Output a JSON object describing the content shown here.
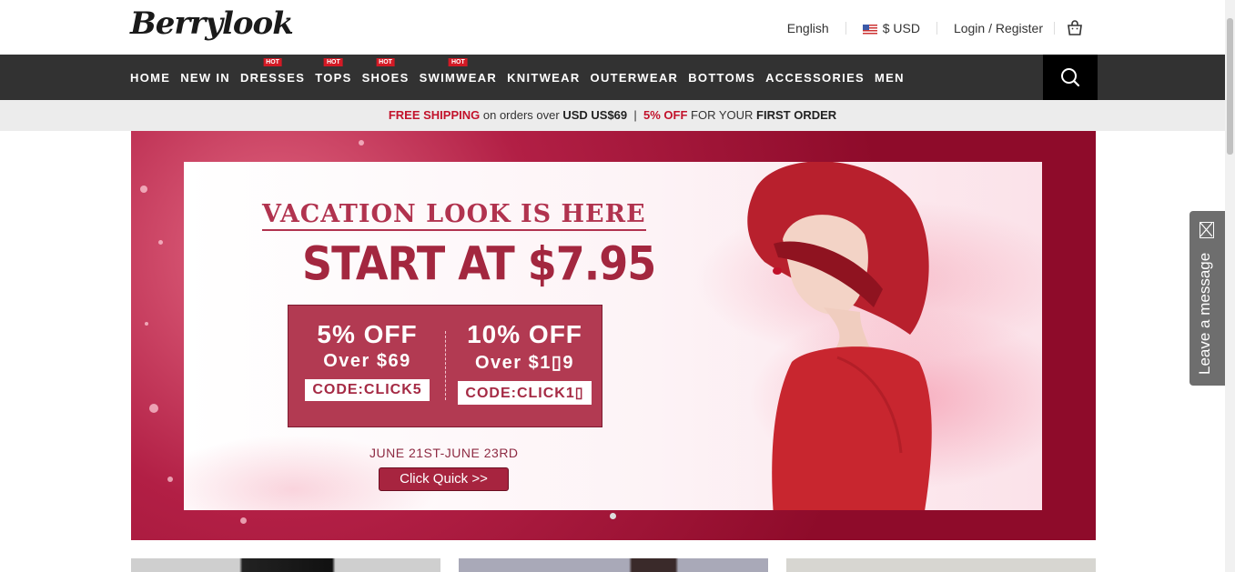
{
  "header": {
    "logo": "Berrylook",
    "language": "English",
    "currency": "$ USD",
    "login": "Login / Register"
  },
  "nav": {
    "items": [
      {
        "label": "HOME",
        "hot": ""
      },
      {
        "label": "NEW IN",
        "hot": ""
      },
      {
        "label": "DRESSES",
        "hot": "HOT"
      },
      {
        "label": "TOPS",
        "hot": "HOT"
      },
      {
        "label": "SHOES",
        "hot": "HOT"
      },
      {
        "label": "SWIMWEAR",
        "hot": "HOT"
      },
      {
        "label": "KNITWEAR",
        "hot": ""
      },
      {
        "label": "OUTERWEAR",
        "hot": ""
      },
      {
        "label": "BOTTOMS",
        "hot": ""
      },
      {
        "label": "ACCESSORIES",
        "hot": ""
      },
      {
        "label": "MEN",
        "hot": ""
      }
    ]
  },
  "shipping": {
    "free": "FREE SHIPPING",
    "on_orders": "on orders over",
    "amount": "USD US$69",
    "sep": "|",
    "off": "5% OFF",
    "for_your": "FOR YOUR",
    "first": "FIRST ORDER"
  },
  "banner": {
    "title": "VACATION LOOK IS HERE",
    "start": "START AT $7.95",
    "coupons": [
      {
        "off": "5% OFF",
        "over": "Over $69",
        "code": "CODE:CLICK5"
      },
      {
        "off": "10% OFF",
        "over": "Over $1▯9",
        "code": "CODE:CLICK1▯"
      }
    ],
    "date": "JUNE 21ST-JUNE 23RD",
    "cta": "Click Quick >>"
  },
  "leave_message": "Leave a message",
  "colors": {
    "nav_bg": "#323232",
    "accent": "#c2122b",
    "banner": "#8e0b2a"
  }
}
